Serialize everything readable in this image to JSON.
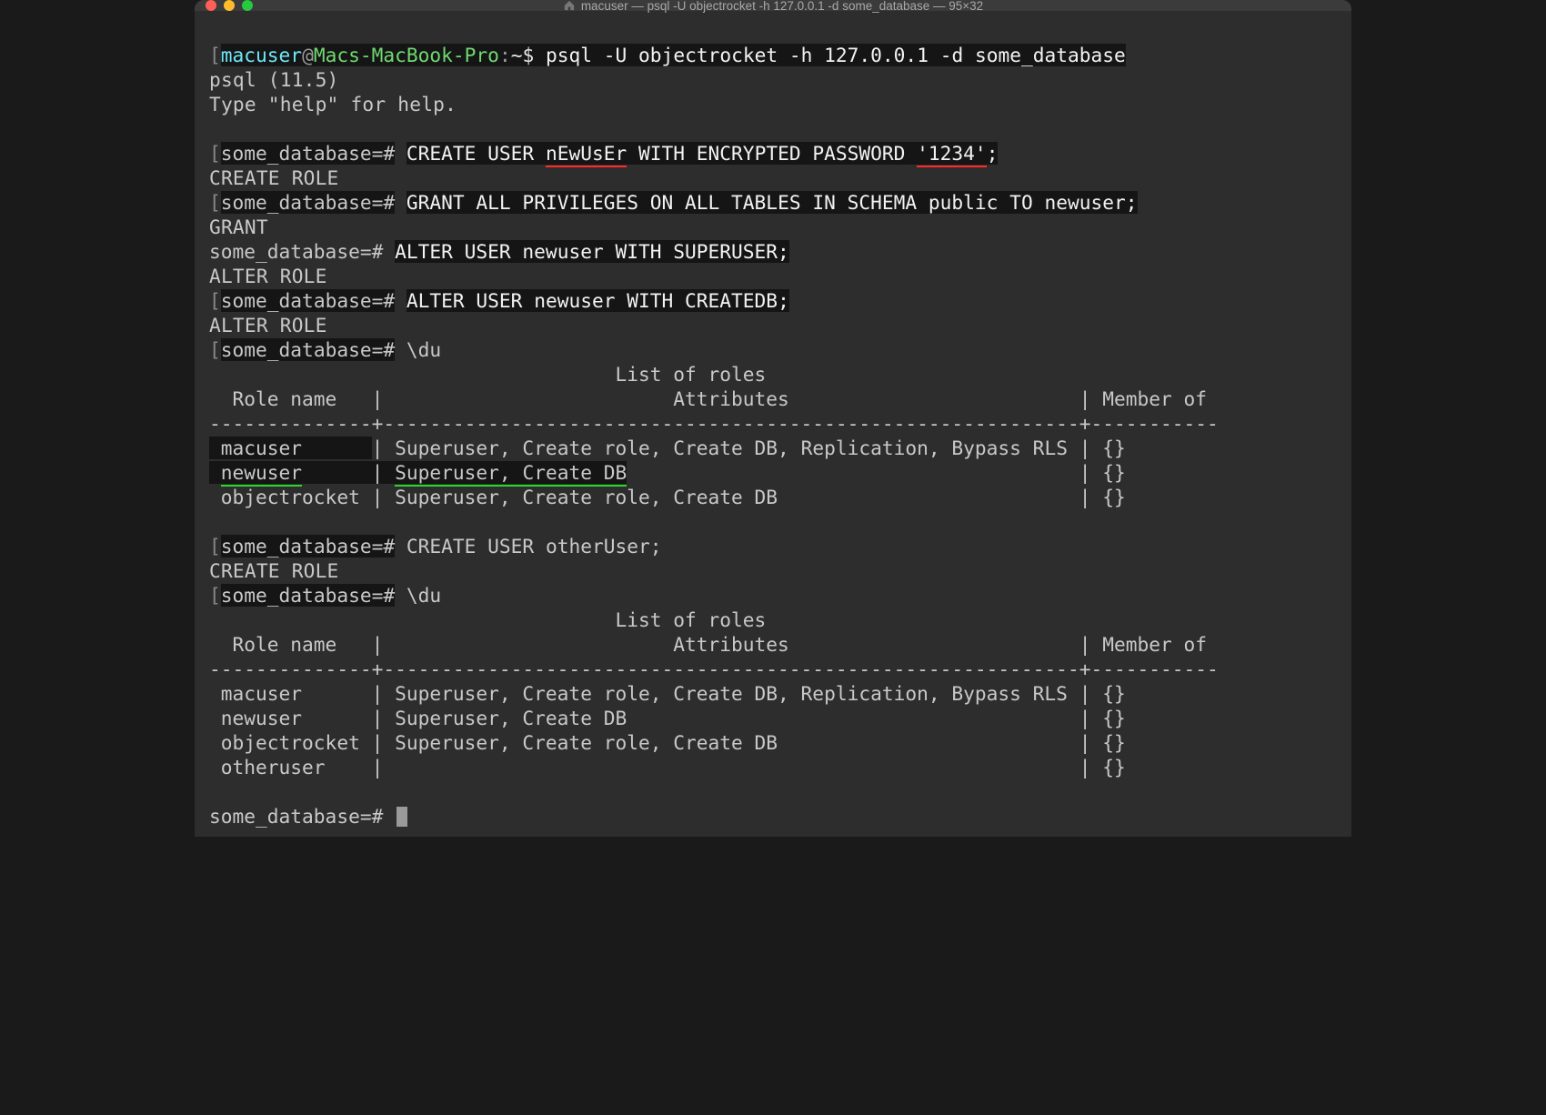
{
  "window": {
    "title": "macuser — psql -U objectrocket -h 127.0.0.1 -d some_database — 95×32"
  },
  "prompt": {
    "user": "macuser",
    "at": "@",
    "host": "Macs-MacBook-Pro",
    "colon": ":",
    "path": "~",
    "sigil": "$"
  },
  "shell_cmd": "psql -U objectrocket -h 127.0.0.1 -d some_database",
  "psql": {
    "banner1": "psql (11.5)",
    "banner2": "Type \"help\" for help.",
    "prompt": "some_database=#"
  },
  "cmds": {
    "create_user_pre": "CREATE USER ",
    "create_user_name": "nEwUsEr",
    "create_user_mid": " WITH ENCRYPTED PASSWORD ",
    "create_user_pwd": "'1234'",
    "create_user_post": ";",
    "grant": "GRANT ALL PRIVILEGES ON ALL TABLES IN SCHEMA public TO newuser;",
    "alter_su": "ALTER USER newuser WITH SUPERUSER;",
    "alter_cdb": "ALTER USER newuser WITH CREATEDB;",
    "du": "\\du",
    "create_other": "CREATE USER otherUser;"
  },
  "resp": {
    "create_role": "CREATE ROLE",
    "grant": "GRANT",
    "alter_role": "ALTER ROLE"
  },
  "roles1": {
    "title": "                                   List of roles",
    "hdr_role": "  Role name   |",
    "hdr_attr": "                         Attributes                         ",
    "hdr_mem": "| Member of ",
    "sep": "--------------+------------------------------------------------------------+-----------",
    "r1a": " macuser      ",
    "r1b": "| Superuser, Create role, Create DB, Replication, Bypass RLS | {}",
    "r2a_pre": " ",
    "r2a_name": "newuser",
    "r2a_pad": "      ",
    "r2b_pre": "| ",
    "r2b_attr": "Superuser, Create DB",
    "r2b_pad": "                                       ",
    "r2b_tail": "| {}",
    "r3a": " objectrocket ",
    "r3b": "| Superuser, Create role, Create DB                          | {}"
  },
  "roles2": {
    "title": "                                   List of roles",
    "hdr": "  Role name   |                         Attributes                         | Member of ",
    "sep": "--------------+------------------------------------------------------------+-----------",
    "r1": " macuser      | Superuser, Create role, Create DB, Replication, Bypass RLS | {}",
    "r2": " newuser      | Superuser, Create DB                                       | {}",
    "r3": " objectrocket | Superuser, Create role, Create DB                          | {}",
    "r4": " otheruser    |                                                            | {}"
  }
}
